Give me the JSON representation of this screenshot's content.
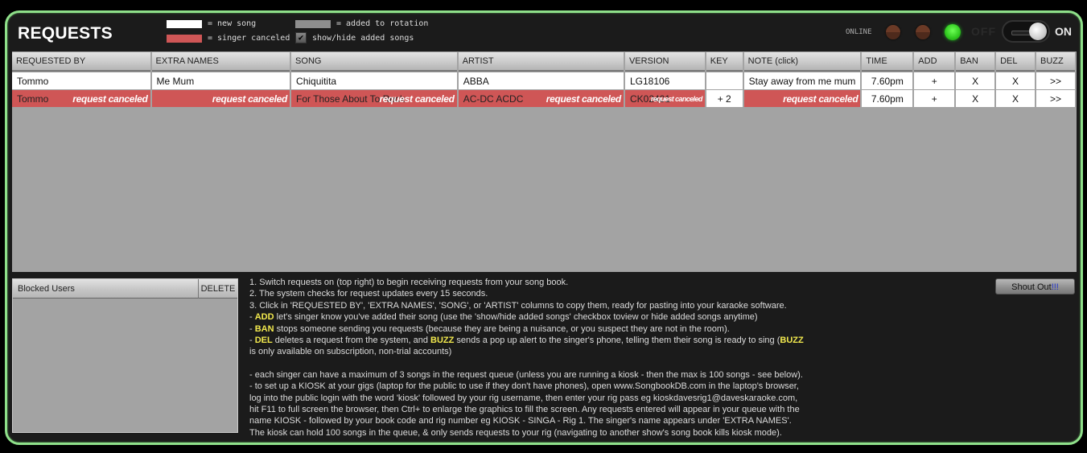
{
  "header": {
    "title": "REQUESTS",
    "legend": [
      {
        "swatch_color": "#ffffff",
        "label": "= new song"
      },
      {
        "swatch_color": "#cf5656",
        "label": "= singer canceled"
      },
      {
        "swatch_color": "#8e8e8e",
        "label": "= added to rotation"
      }
    ],
    "show_hide_checkbox": {
      "label": "show/hide added songs",
      "checked": true,
      "glyph": "✔"
    },
    "status": {
      "online_label": "ONLINE",
      "indicators": [
        "off",
        "off",
        "on"
      ],
      "off_label": "OFF",
      "on_label": "ON",
      "switch_state": "on"
    }
  },
  "table": {
    "columns": [
      "REQUESTED BY",
      "EXTRA NAMES",
      "SONG",
      "ARTIST",
      "VERSION",
      "KEY",
      "NOTE (click)",
      "TIME",
      "ADD",
      "BAN",
      "DEL",
      "BUZZ"
    ],
    "canceled_tag": "request canceled",
    "rows": [
      {
        "status": "new",
        "requested_by": "Tommo",
        "extra_names": "Me Mum",
        "song": "Chiquitita",
        "artist": "ABBA",
        "version": "LG18106",
        "key": "",
        "note": "Stay away from me mum",
        "time": "7.60pm",
        "add": "+",
        "ban": "X",
        "del": "X",
        "buzz": ">>"
      },
      {
        "status": "canceled",
        "requested_by": "Tommo",
        "extra_names": "",
        "song": "For Those About To Rock",
        "artist": "AC-DC ACDC",
        "version": "CK02401",
        "key": "+ 2",
        "note": "",
        "time": "7.60pm",
        "add": "+",
        "ban": "X",
        "del": "X",
        "buzz": ">>"
      }
    ]
  },
  "blocked_users": {
    "header": "Blocked Users",
    "delete_label": "DELETE",
    "items": []
  },
  "help": {
    "line1": "1. Switch requests on (top right) to begin receiving requests from your song book.",
    "line2": "2. The system checks for request updates every 15 seconds.",
    "line3": "3. Click in 'REQUESTED BY', 'EXTRA NAMES', 'SONG', or 'ARTIST' columns to copy them, ready for pasting into your karaoke software.",
    "add_kw": "ADD",
    "add_text": " let's singer know you've added their song (use the 'show/hide added songs' checkbox toview or hide added songs anytime)",
    "ban_kw": "BAN",
    "ban_text": " stops someone sending you requests (because they are being a nuisance, or you suspect they are not in the room).",
    "del_kw": "DEL",
    "del_text": " deletes a request from the system, and ",
    "buzz_kw": "BUZZ",
    "buzz_text": " sends a pop up alert to the singer's phone, telling them their song is ready to sing (",
    "buzz_kw2": "BUZZ",
    "buzz_tail": "is only available on subscription, non-trial accounts)",
    "kiosk_lines": [
      "- each singer can have a maximum of 3 songs in the request queue (unless you are running a kiosk - then the max is 100 songs - see below).",
      "- to set up a KIOSK at your gigs (laptop for the public to use if they don't have phones), open www.SongbookDB.com in the laptop's browser,",
      "log into the public login with the word 'kiosk' followed by your rig username, then enter your rig pass eg kioskdavesrig1@daveskaraoke.com,",
      "hit F11 to full screen the browser, then Ctrl+ to enlarge the graphics to fill the screen. Any requests entered will appear in your queue with the",
      "name KIOSK - followed by your book code and rig number eg KIOSK - SINGA - Rig 1. The singer's name appears under 'EXTRA NAMES'.",
      "The kiosk can hold 100 songs in the queue, & only sends requests to your rig (navigating to another show's song book kills kiosk mode)."
    ]
  },
  "shout_button": {
    "label": "Shout Out",
    "suffix": "!!!"
  }
}
